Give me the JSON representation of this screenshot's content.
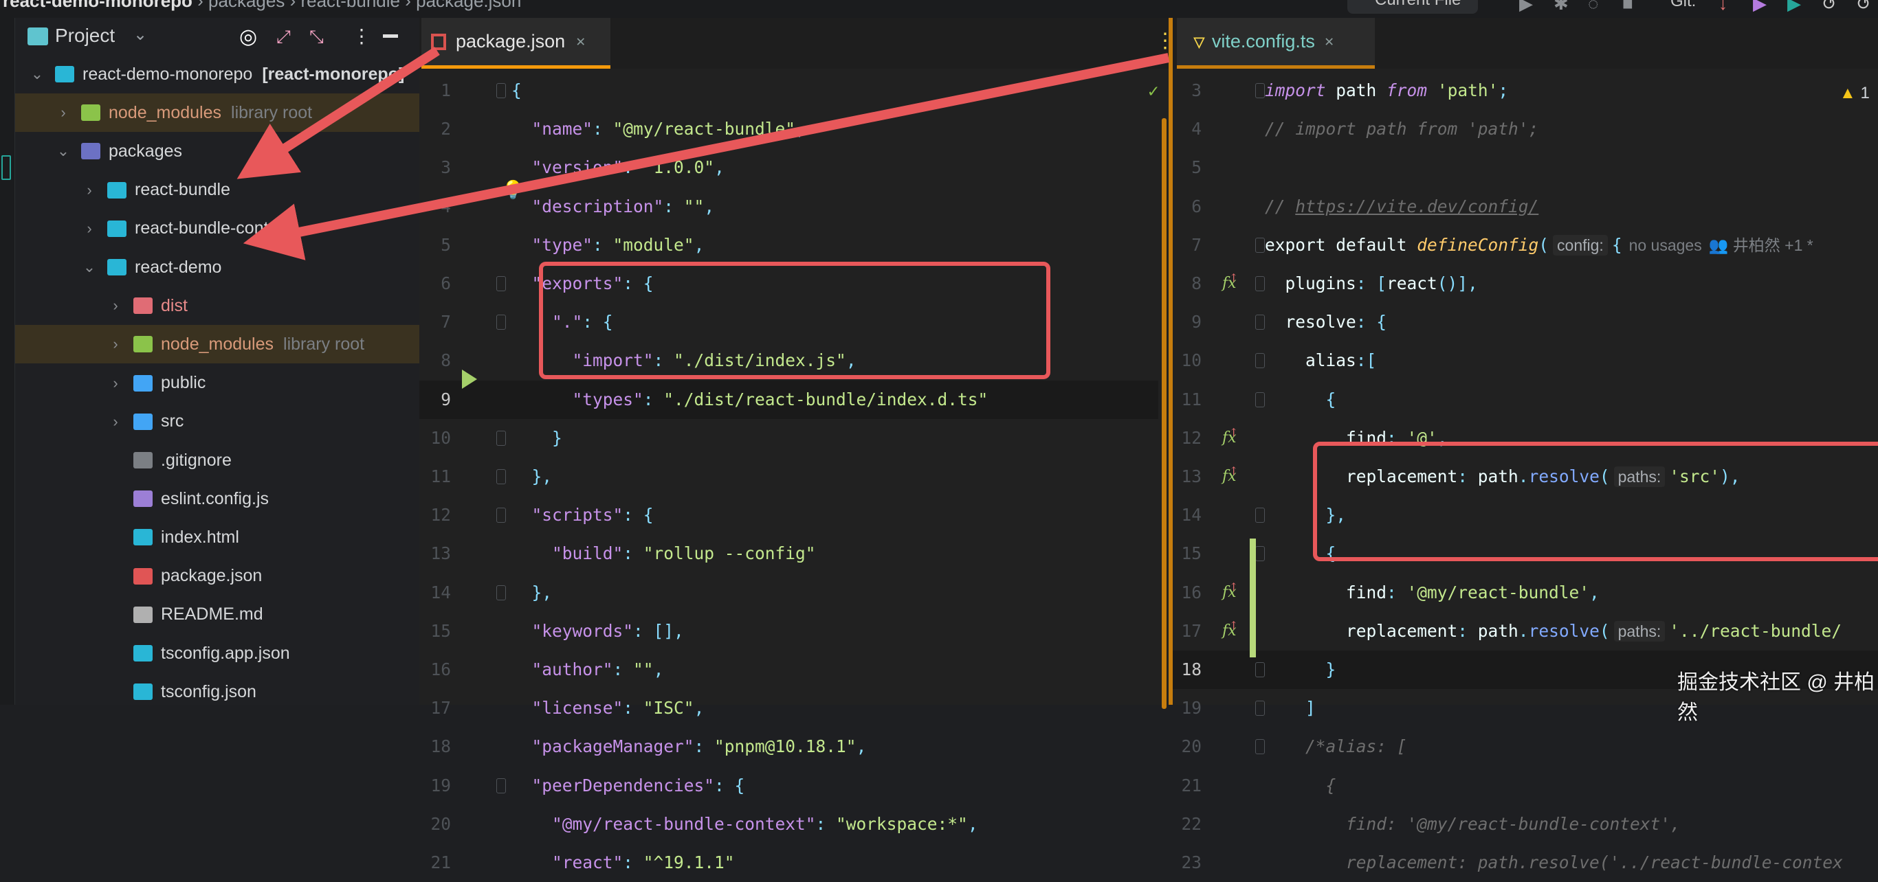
{
  "breadcrumb": [
    "react-demo-monorepo",
    "packages",
    "react-bundle",
    "package.json"
  ],
  "toolbar": {
    "run_config": "Current File",
    "vcs_label": "Git:"
  },
  "project_panel": {
    "title": "Project",
    "tree": [
      {
        "label": "react-demo-monorepo",
        "suffix": "[react-monorepo]",
        "depth": 0,
        "chevron": "down",
        "icon": "react-folder-icon",
        "color": "#29b6d6"
      },
      {
        "label": "node_modules",
        "suffix": "library root",
        "depth": 1,
        "chevron": "right",
        "icon": "node-folder-icon",
        "color": "#8bc34a",
        "library": true
      },
      {
        "label": "packages",
        "depth": 1,
        "chevron": "down",
        "icon": "packages-folder-icon",
        "color": "#6c71c4"
      },
      {
        "label": "react-bundle",
        "depth": 2,
        "chevron": "right",
        "icon": "react-folder-icon",
        "color": "#29b6d6"
      },
      {
        "label": "react-bundle-context",
        "depth": 2,
        "chevron": "right",
        "icon": "react-folder-icon",
        "color": "#29b6d6"
      },
      {
        "label": "react-demo",
        "depth": 2,
        "chevron": "down",
        "icon": "react-folder-icon",
        "color": "#29b6d6"
      },
      {
        "label": "dist",
        "depth": 3,
        "chevron": "right",
        "icon": "dist-folder-icon",
        "color": "#e06c75",
        "labelColor": "#e88a8a"
      },
      {
        "label": "node_modules",
        "suffix": "library root",
        "depth": 3,
        "chevron": "right",
        "icon": "node-folder-icon",
        "color": "#8bc34a",
        "library": true
      },
      {
        "label": "public",
        "depth": 3,
        "chevron": "right",
        "icon": "public-folder-icon",
        "color": "#42a5f5"
      },
      {
        "label": "src",
        "depth": 3,
        "chevron": "right",
        "icon": "src-folder-icon",
        "color": "#42a5f5"
      },
      {
        "label": ".gitignore",
        "depth": 3,
        "icon": "git-icon",
        "color": "#7b7f84"
      },
      {
        "label": "eslint.config.js",
        "depth": 3,
        "icon": "eslint-icon",
        "color": "#9c7fd6"
      },
      {
        "label": "index.html",
        "depth": 3,
        "icon": "html-icon",
        "color": "#29b6d6"
      },
      {
        "label": "package.json",
        "depth": 3,
        "icon": "npm-icon",
        "color": "#e05555"
      },
      {
        "label": "README.md",
        "depth": 3,
        "icon": "markdown-icon",
        "color": "#b0b0b0"
      },
      {
        "label": "tsconfig.app.json",
        "depth": 3,
        "icon": "tsconfig-icon",
        "color": "#29b6d6"
      },
      {
        "label": "tsconfig.json",
        "depth": 3,
        "icon": "tsconfig-icon",
        "color": "#29b6d6"
      }
    ]
  },
  "left_editor": {
    "tab": "package.json",
    "first_line": 1,
    "current_line": 9,
    "lines": [
      [
        [
          "p",
          "{"
        ]
      ],
      [
        [
          "t",
          "  "
        ],
        [
          "k",
          "\"name\""
        ],
        [
          "p",
          ": "
        ],
        [
          "s",
          "\"@my/react-bundle\""
        ],
        [
          "p",
          ","
        ]
      ],
      [
        [
          "t",
          "  "
        ],
        [
          "k",
          "\"version\""
        ],
        [
          "p",
          ": "
        ],
        [
          "s",
          "\"1.0.0\""
        ],
        [
          "p",
          ","
        ]
      ],
      [
        [
          "t",
          "  "
        ],
        [
          "k",
          "\"description\""
        ],
        [
          "p",
          ": "
        ],
        [
          "s",
          "\"\""
        ],
        [
          "p",
          ","
        ]
      ],
      [
        [
          "t",
          "  "
        ],
        [
          "k",
          "\"type\""
        ],
        [
          "p",
          ": "
        ],
        [
          "s",
          "\"module\""
        ],
        [
          "p",
          ","
        ]
      ],
      [
        [
          "t",
          "  "
        ],
        [
          "k",
          "\"exports\""
        ],
        [
          "p",
          ": {"
        ]
      ],
      [
        [
          "t",
          "    "
        ],
        [
          "k",
          "\".\""
        ],
        [
          "p",
          ": {"
        ]
      ],
      [
        [
          "t",
          "      "
        ],
        [
          "k",
          "\"import\""
        ],
        [
          "p",
          ": "
        ],
        [
          "s",
          "\"./dist/index.js\""
        ],
        [
          "p",
          ","
        ]
      ],
      [
        [
          "t",
          "      "
        ],
        [
          "k",
          "\"types\""
        ],
        [
          "p",
          ": "
        ],
        [
          "s",
          "\"./dist/react-bundle/index.d.ts\""
        ]
      ],
      [
        [
          "t",
          "    "
        ],
        [
          "p",
          "}"
        ]
      ],
      [
        [
          "t",
          "  "
        ],
        [
          "p",
          "},"
        ]
      ],
      [
        [
          "t",
          "  "
        ],
        [
          "k",
          "\"scripts\""
        ],
        [
          "p",
          ": {"
        ]
      ],
      [
        [
          "t",
          "    "
        ],
        [
          "k",
          "\"build\""
        ],
        [
          "p",
          ": "
        ],
        [
          "s",
          "\"rollup --config\""
        ]
      ],
      [
        [
          "t",
          "  "
        ],
        [
          "p",
          "},"
        ]
      ],
      [
        [
          "t",
          "  "
        ],
        [
          "k",
          "\"keywords\""
        ],
        [
          "p",
          ": [],"
        ]
      ],
      [
        [
          "t",
          "  "
        ],
        [
          "k",
          "\"author\""
        ],
        [
          "p",
          ": "
        ],
        [
          "s",
          "\"\""
        ],
        [
          "p",
          ","
        ]
      ],
      [
        [
          "t",
          "  "
        ],
        [
          "k",
          "\"license\""
        ],
        [
          "p",
          ": "
        ],
        [
          "s",
          "\"ISC\""
        ],
        [
          "p",
          ","
        ]
      ],
      [
        [
          "t",
          "  "
        ],
        [
          "k",
          "\"packageManager\""
        ],
        [
          "p",
          ": "
        ],
        [
          "s",
          "\"pnpm@10.18.1\""
        ],
        [
          "p",
          ","
        ]
      ],
      [
        [
          "t",
          "  "
        ],
        [
          "k",
          "\"peerDependencies\""
        ],
        [
          "p",
          ": {"
        ]
      ],
      [
        [
          "t",
          "    "
        ],
        [
          "k",
          "\"@my/react-bundle-context\""
        ],
        [
          "p",
          ": "
        ],
        [
          "s",
          "\"workspace:*\""
        ],
        [
          "p",
          ","
        ]
      ],
      [
        [
          "t",
          "    "
        ],
        [
          "k",
          "\"react\""
        ],
        [
          "p",
          ": "
        ],
        [
          "s",
          "\"^19.1.1\""
        ]
      ]
    ]
  },
  "right_editor": {
    "tab": "vite.config.ts",
    "first_line": 3,
    "current_line": 18,
    "warning_count": "1",
    "lines": [
      [
        [
          "kw",
          "import"
        ],
        [
          "t",
          " path "
        ],
        [
          "kw",
          "from"
        ],
        [
          "t",
          " "
        ],
        [
          "s",
          "'path'"
        ],
        [
          "p",
          ";"
        ]
      ],
      [
        [
          "c",
          "// import path from 'path';"
        ]
      ],
      [],
      [
        [
          "c",
          "// "
        ],
        [
          "u",
          "https://vite.dev/config/"
        ]
      ],
      [
        [
          "t",
          "export default "
        ],
        [
          "fn",
          "defineConfig"
        ],
        [
          "p",
          "("
        ],
        [
          "h",
          "config:"
        ],
        [
          "p",
          "{"
        ],
        [
          "n",
          "no usages"
        ],
        [
          "n",
          "👥 井柏然 +1 *"
        ]
      ],
      [
        [
          "t",
          "  plugins"
        ],
        [
          "p",
          ": ["
        ],
        [
          "t",
          "react"
        ],
        [
          "p",
          "()],"
        ]
      ],
      [
        [
          "t",
          "  resolve"
        ],
        [
          "p",
          ": {"
        ]
      ],
      [
        [
          "t",
          "    alias"
        ],
        [
          "p",
          ":["
        ]
      ],
      [
        [
          "t",
          "      "
        ],
        [
          "p",
          "{"
        ]
      ],
      [
        [
          "t",
          "        find"
        ],
        [
          "p",
          ": "
        ],
        [
          "s",
          "'@'"
        ],
        [
          "p",
          ","
        ]
      ],
      [
        [
          "t",
          "        replacement"
        ],
        [
          "p",
          ": "
        ],
        [
          "t",
          "path"
        ],
        [
          "p",
          "."
        ],
        [
          "m",
          "resolve"
        ],
        [
          "p",
          "("
        ],
        [
          "h",
          "paths:"
        ],
        [
          "s",
          "'src'"
        ],
        [
          "p",
          "),"
        ]
      ],
      [
        [
          "t",
          "      "
        ],
        [
          "p",
          "},"
        ]
      ],
      [
        [
          "t",
          "      "
        ],
        [
          "p",
          "{"
        ]
      ],
      [
        [
          "t",
          "        find"
        ],
        [
          "p",
          ": "
        ],
        [
          "s",
          "'@my/react-bundle'"
        ],
        [
          "p",
          ","
        ]
      ],
      [
        [
          "t",
          "        replacement"
        ],
        [
          "p",
          ": "
        ],
        [
          "t",
          "path"
        ],
        [
          "p",
          "."
        ],
        [
          "m",
          "resolve"
        ],
        [
          "p",
          "("
        ],
        [
          "h",
          "paths:"
        ],
        [
          "s",
          "'../react-bundle/"
        ]
      ],
      [
        [
          "t",
          "      "
        ],
        [
          "p",
          "}"
        ]
      ],
      [
        [
          "t",
          "    "
        ],
        [
          "p",
          "]"
        ]
      ],
      [
        [
          "t",
          "    "
        ],
        [
          "ci",
          "/*alias: ["
        ]
      ],
      [
        [
          "t",
          "      "
        ],
        [
          "ci",
          "{"
        ]
      ],
      [
        [
          "t",
          "        "
        ],
        [
          "ci",
          "find: '@my/react-bundle-context',"
        ]
      ],
      [
        [
          "t",
          "        "
        ],
        [
          "ci",
          "replacement: path.resolve('../react-bundle-contex"
        ]
      ]
    ]
  },
  "watermark": "掘金技术社区 @ 井柏然",
  "colors": {
    "accent_tab": "#f59a0c",
    "annotation": "#e8585a",
    "library_row": "#3a3220"
  }
}
